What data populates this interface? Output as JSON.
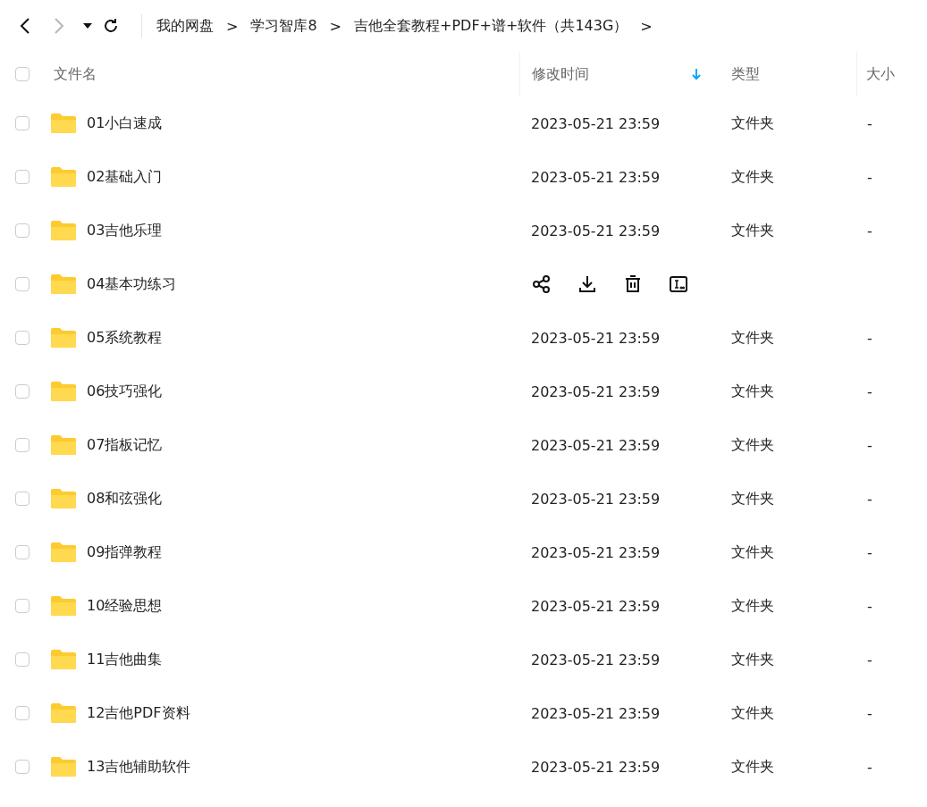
{
  "nav": {
    "breadcrumb": [
      "我的网盘",
      "学习智库8",
      "吉他全套教程+PDF+谱+软件（共143G）"
    ],
    "separator": ">"
  },
  "table": {
    "select_all": {
      "checked": false
    },
    "columns": [
      {
        "label": "文件名",
        "sorted": false
      },
      {
        "label": "修改时间",
        "sorted": true
      },
      {
        "label": "类型",
        "sorted": false
      },
      {
        "label": "大小",
        "sorted": false
      }
    ],
    "rows": [
      {
        "name": "01小白速成",
        "modified": "2023-05-21 23:59",
        "type": "文件夹",
        "size": "-",
        "checked": false,
        "hovered": false
      },
      {
        "name": "02基础入门",
        "modified": "2023-05-21 23:59",
        "type": "文件夹",
        "size": "-",
        "checked": false,
        "hovered": false
      },
      {
        "name": "03吉他乐理",
        "modified": "2023-05-21 23:59",
        "type": "文件夹",
        "size": "-",
        "checked": false,
        "hovered": false
      },
      {
        "name": "04基本功练习",
        "checked": false,
        "hovered": true
      },
      {
        "name": "05系统教程",
        "modified": "2023-05-21 23:59",
        "type": "文件夹",
        "size": "-",
        "checked": false,
        "hovered": false
      },
      {
        "name": "06技巧强化",
        "modified": "2023-05-21 23:59",
        "type": "文件夹",
        "size": "-",
        "checked": false,
        "hovered": false
      },
      {
        "name": "07指板记忆",
        "modified": "2023-05-21 23:59",
        "type": "文件夹",
        "size": "-",
        "checked": false,
        "hovered": false
      },
      {
        "name": "08和弦强化",
        "modified": "2023-05-21 23:59",
        "type": "文件夹",
        "size": "-",
        "checked": false,
        "hovered": false
      },
      {
        "name": "09指弹教程",
        "modified": "2023-05-21 23:59",
        "type": "文件夹",
        "size": "-",
        "checked": false,
        "hovered": false
      },
      {
        "name": "10经验思想",
        "modified": "2023-05-21 23:59",
        "type": "文件夹",
        "size": "-",
        "checked": false,
        "hovered": false
      },
      {
        "name": "11吉他曲集",
        "modified": "2023-05-21 23:59",
        "type": "文件夹",
        "size": "-",
        "checked": false,
        "hovered": false
      },
      {
        "name": "12吉他PDF资料",
        "modified": "2023-05-21 23:59",
        "type": "文件夹",
        "size": "-",
        "checked": false,
        "hovered": false
      },
      {
        "name": "13吉他辅助软件",
        "modified": "2023-05-21 23:59",
        "type": "文件夹",
        "size": "-",
        "checked": false,
        "hovered": false
      }
    ]
  }
}
